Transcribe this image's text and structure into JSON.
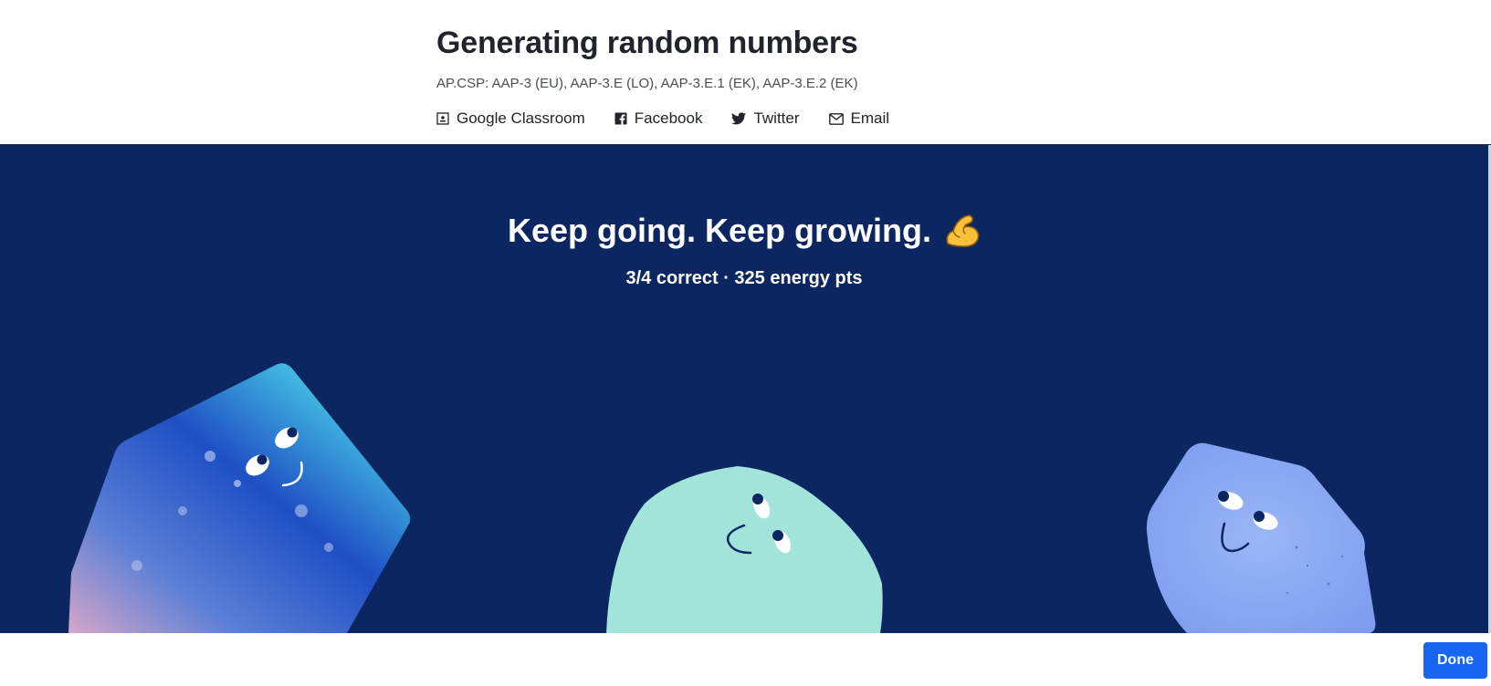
{
  "header": {
    "title": "Generating random numbers",
    "standards": "AP.CSP: AAP-3 (EU), AAP-3.E (LO), AAP-3.E.1 (EK), AAP-3.E.2 (EK)",
    "share": [
      {
        "label": "Google Classroom",
        "icon": "google-classroom-icon"
      },
      {
        "label": "Facebook",
        "icon": "facebook-icon"
      },
      {
        "label": "Twitter",
        "icon": "twitter-icon"
      },
      {
        "label": "Email",
        "icon": "email-icon"
      }
    ]
  },
  "result": {
    "headline": "Keep going. Keep growing.",
    "emoji": "flexed-biceps-icon",
    "score": "3/4 correct · 325 energy pts"
  },
  "footer": {
    "done_label": "Done"
  },
  "colors": {
    "hero_bg": "#0b2661",
    "done_button": "#1865f2",
    "left_blob": "#2f6fd8",
    "middle_blob": "#a3e4da",
    "right_blob": "#8aa8f2"
  }
}
